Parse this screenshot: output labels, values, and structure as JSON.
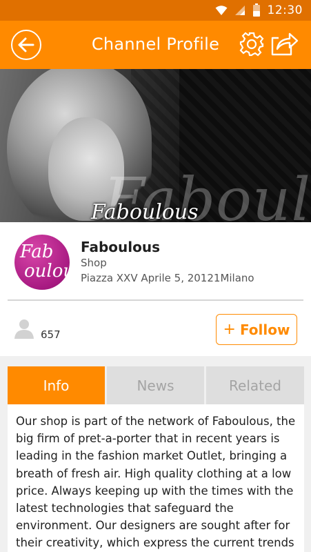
{
  "status_bar": {
    "time": "12:30",
    "icons": [
      "wifi-icon",
      "signal-icon",
      "battery-icon"
    ],
    "color": "#e07000"
  },
  "toolbar": {
    "title": "Channel Profile",
    "back_icon": "back-arrow-icon",
    "settings_icon": "gear-icon",
    "share_icon": "share-icon",
    "color": "#ff8a00"
  },
  "banner": {
    "large_text": "Faboulous",
    "small_text": "Faboulous"
  },
  "profile": {
    "logo_text_line1": "Fab",
    "logo_text_line2": "oulous",
    "name": "Faboulous",
    "category": "Shop",
    "address": "Piazza XXV Aprile 5, 20121Milano"
  },
  "followers": {
    "icon": "user-icon",
    "count": "657",
    "follow_plus": "+",
    "follow_label": "Follow"
  },
  "tabs": [
    {
      "label": "Info",
      "active": true
    },
    {
      "label": "News",
      "active": false
    },
    {
      "label": "Related",
      "active": false
    }
  ],
  "info_text": "Our shop is part of the network of Faboulous, the big firm of pret-a-porter that in recent years is leading in the fashion market Outlet, bringing a breath of fresh air. High quality clothing at a low price. Always keeping up with the times with the latest technologies that safeguard the environment. Our designers are sought after for their creativity, which express the current trends and combine high"
}
